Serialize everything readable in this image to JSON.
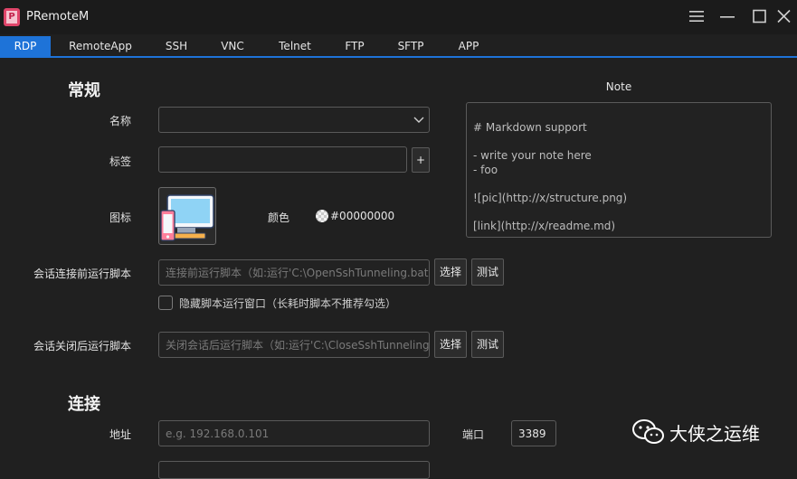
{
  "window": {
    "title": "PRemoteM",
    "logo_letter": "P"
  },
  "tabs": [
    {
      "label": "RDP",
      "active": true
    },
    {
      "label": "RemoteApp"
    },
    {
      "label": "SSH"
    },
    {
      "label": "VNC"
    },
    {
      "label": "Telnet"
    },
    {
      "label": "FTP"
    },
    {
      "label": "SFTP"
    },
    {
      "label": "APP"
    }
  ],
  "general": {
    "section_title": "常规",
    "name_label": "名称",
    "tag_label": "标签",
    "tag_add_label": "+",
    "icon_label": "图标",
    "color_label": "颜色",
    "color_value": "#00000000"
  },
  "note": {
    "title": "Note",
    "lines": [
      "# Markdown support",
      "",
      "- write your note here",
      "- foo",
      "",
      "![pic](http://x/structure.png)",
      "",
      "[link](http://x/readme.md)"
    ]
  },
  "pre_script": {
    "label": "会话连接前运行脚本",
    "placeholder": "连接前运行脚本（如:运行'C:\\OpenSshTunneling.bat",
    "select_label": "选择",
    "test_label": "测试",
    "hide_window_label": "隐藏脚本运行窗口（长耗时脚本不推荐勾选）"
  },
  "post_script": {
    "label": "会话关闭后运行脚本",
    "placeholder": "关闭会话后运行脚本（如:运行'C:\\CloseSshTunneling",
    "select_label": "选择",
    "test_label": "测试"
  },
  "connection": {
    "section_title": "连接",
    "address_label": "地址",
    "address_placeholder": "e.g. 192.168.0.101",
    "port_label": "端口",
    "port_value": "3389"
  },
  "watermark": {
    "text": "大侠之运维"
  },
  "colors": {
    "accent": "#1e73d8",
    "background": "#202020",
    "logo": "#e0456a"
  }
}
